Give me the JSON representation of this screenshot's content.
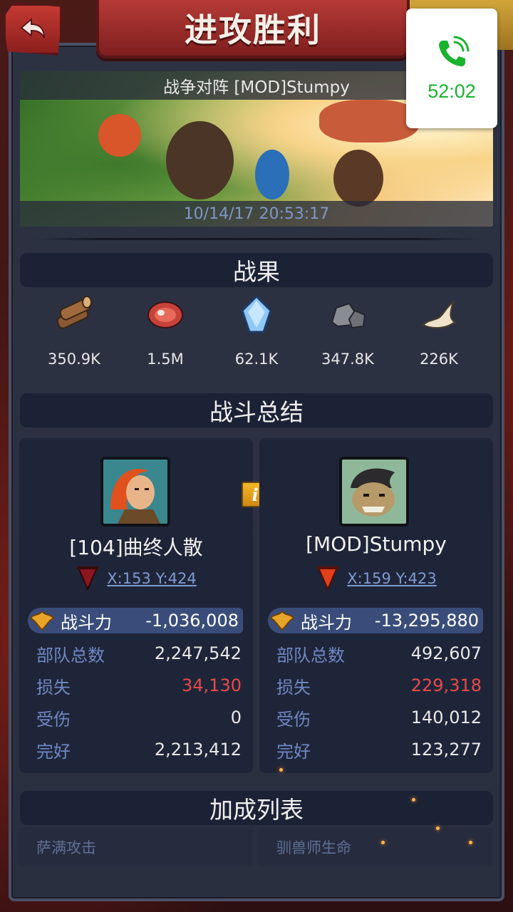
{
  "header": {
    "title": "进攻胜利",
    "back_icon": "back-arrow-icon"
  },
  "call_overlay": {
    "icon": "phone-call-icon",
    "duration": "52:02",
    "color": "#19b32e"
  },
  "battle": {
    "opponent_text": "战争对阵 [MOD]Stumpy",
    "timestamp": "10/14/17 20:53:17"
  },
  "sections": {
    "rewards": "战果",
    "summary": "战斗总结",
    "bonuses": "加成列表"
  },
  "rewards": [
    {
      "icon": "wood-log-icon",
      "value": "350.9K"
    },
    {
      "icon": "meat-icon",
      "value": "1.5M"
    },
    {
      "icon": "crystal-icon",
      "value": "62.1K"
    },
    {
      "icon": "stone-icon",
      "value": "347.8K"
    },
    {
      "icon": "bone-icon",
      "value": "226K"
    }
  ],
  "players": {
    "left": {
      "name": "[104]曲终人散",
      "coords": "X:153 Y:424",
      "power_label": "战斗力",
      "power_value": "-1,036,008",
      "stats": [
        {
          "label": "部队总数",
          "value": "2,247,542"
        },
        {
          "label": "损失",
          "value": "34,130",
          "highlight": "#e84a4a"
        },
        {
          "label": "受伤",
          "value": "0"
        },
        {
          "label": "完好",
          "value": "2,213,412"
        }
      ]
    },
    "right": {
      "name": "[MOD]Stumpy",
      "coords": "X:159 Y:423",
      "power_label": "战斗力",
      "power_value": "-13,295,880",
      "stats": [
        {
          "label": "部队总数",
          "value": "492,607"
        },
        {
          "label": "损失",
          "value": "229,318",
          "highlight": "#e84a4a"
        },
        {
          "label": "受伤",
          "value": "140,012"
        },
        {
          "label": "完好",
          "value": "123,277"
        }
      ]
    }
  },
  "info_button": "i",
  "bonus_list": [
    "萨满攻击",
    "驯兽师生命"
  ]
}
